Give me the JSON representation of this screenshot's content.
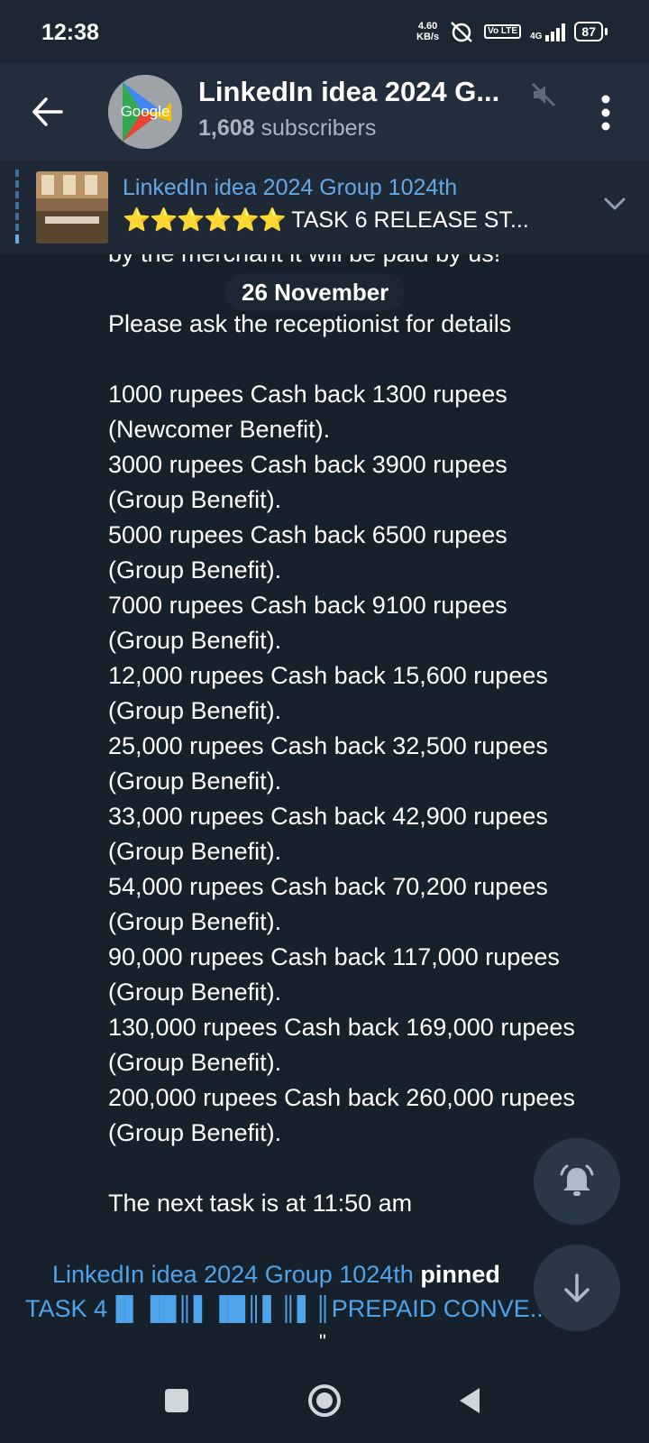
{
  "status": {
    "time": "12:38",
    "speed_value": "4.60",
    "speed_unit": "KB/s",
    "volte": "Vo LTE",
    "network": "4G",
    "battery": "87"
  },
  "header": {
    "title": "LinkedIn idea 2024 G...",
    "subscribers_count": "1,608",
    "subscribers_label": "subscribers",
    "avatar_text": "Google"
  },
  "pinned": {
    "title": "LinkedIn idea 2024 Group 1024th",
    "stars": "⭐⭐⭐⭐⭐⭐",
    "text": "TASK 6 RELEASE ST..."
  },
  "date_chip": "26 November",
  "message": {
    "partial_top": "by the merchant it will be paid by us!",
    "ask": "Please ask the receptionist  for details",
    "lines": [
      "1000 rupees Cash back 1300 rupees (Newcomer Benefit).",
      "3000 rupees  Cash back 3900 rupees (Group Benefit).",
      "5000 rupees  Cash back 6500 rupees (Group Benefit).",
      "7000 rupees   Cash back 9100 rupees (Group Benefit).",
      "12,000 rupees  Cash back 15,600 rupees (Group Benefit).",
      "25,000 rupees  Cash back 32,500 rupees (Group Benefit).",
      "33,000 rupees  Cash back 42,900 rupees (Group Benefit).",
      "54,000 rupees  Cash back 70,200 rupees (Group Benefit).",
      "90,000 rupees  Cash back 117,000 rupees (Group Benefit).",
      "130,000 rupees  Cash back 169,000 rupees (Group Benefit).",
      "200,000 rupees  Cash back 260,000 rupees (Group Benefit)."
    ],
    "next_task": "The next task is at 11:50 am"
  },
  "service": {
    "channel": "LinkedIn idea 2024 Group 1024th",
    "action": "pinned",
    "task": "TASK 4▐▌▐█║▌▐█║▌║▌║PREPAID CONVE...",
    "quote": "\""
  },
  "icons": {
    "back": "back-arrow-icon",
    "mute": "muted-speaker-icon",
    "menu": "more-vertical-icon",
    "chevron": "chevron-down-icon",
    "bell": "bell-icon",
    "down": "arrow-down-icon"
  },
  "colors": {
    "background": "#17212b",
    "header": "#232e3c",
    "link": "#4ea4ec",
    "stars": "#f7c400"
  }
}
